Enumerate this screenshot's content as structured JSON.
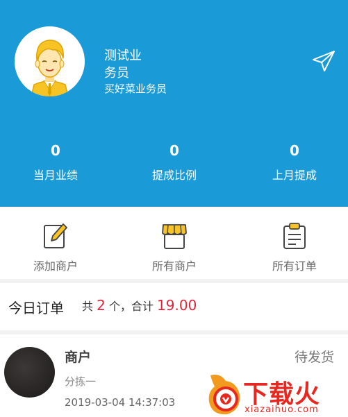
{
  "profile": {
    "name_line1": "测试业",
    "name_line2": "务员",
    "shop": "买好菜业务员"
  },
  "stats": [
    {
      "value": "0",
      "label": "当月业绩"
    },
    {
      "value": "0",
      "label": "提成比例"
    },
    {
      "value": "0",
      "label": "上月提成"
    }
  ],
  "actions": [
    {
      "label": "添加商户",
      "icon": "edit-icon"
    },
    {
      "label": "所有商户",
      "icon": "store-icon"
    },
    {
      "label": "所有订单",
      "icon": "clipboard-icon"
    }
  ],
  "summary": {
    "title": "今日订单",
    "count_prefix": "共",
    "count": "2",
    "count_suffix": "个，合计",
    "total": "19.00"
  },
  "order": {
    "merchant": "商户",
    "status": "待发货",
    "sub": "分拣一",
    "time": "2019-03-04 14:37:03"
  },
  "watermark": {
    "text": "下载火",
    "url": "xiazaihuo.com"
  },
  "colors": {
    "header_bg": "#1a9bd7",
    "accent_red": "#e0253b"
  }
}
